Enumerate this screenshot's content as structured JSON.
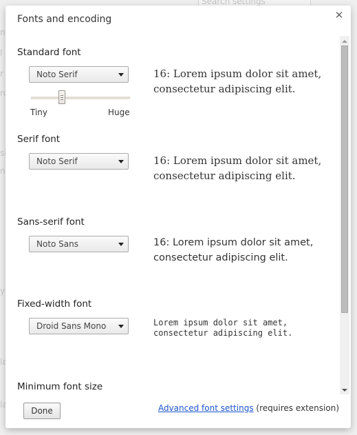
{
  "background": {
    "search_placeholder": "Search settings",
    "left_fragments": [
      "n",
      "l c",
      "r",
      "ro",
      "si",
      "n",
      "ys",
      "la",
      "la"
    ]
  },
  "dialog": {
    "title": "Fonts and encoding",
    "close_icon": "close-x-icon",
    "sections": {
      "standard": {
        "title": "Standard font",
        "selected_font": "Noto Serif",
        "sample": "16: Lorem ipsum dolor sit amet, consectetur adipiscing elit.",
        "size_slider": {
          "min_label": "Tiny",
          "max_label": "Huge",
          "value_fraction": 0.31
        }
      },
      "serif": {
        "title": "Serif font",
        "selected_font": "Noto Serif",
        "sample": "16: Lorem ipsum dolor sit amet, consectetur adipiscing elit."
      },
      "sans_serif": {
        "title": "Sans-serif font",
        "selected_font": "Noto Sans",
        "sample": "16: Lorem ipsum dolor sit amet, consectetur adipiscing elit."
      },
      "fixed_width": {
        "title": "Fixed-width font",
        "selected_font": "Droid Sans Mono",
        "sample": "Lorem ipsum dolor sit amet, consectetur adipiscing elit."
      },
      "minimum": {
        "title": "Minimum font size"
      }
    },
    "footer": {
      "done_label": "Done",
      "advanced_link": "Advanced font settings",
      "advanced_note": " (requires extension)"
    }
  },
  "colors": {
    "link": "#1a55cc",
    "scroll_thumb": "#bcbcbc",
    "slider_track": "#e2ddd6"
  }
}
